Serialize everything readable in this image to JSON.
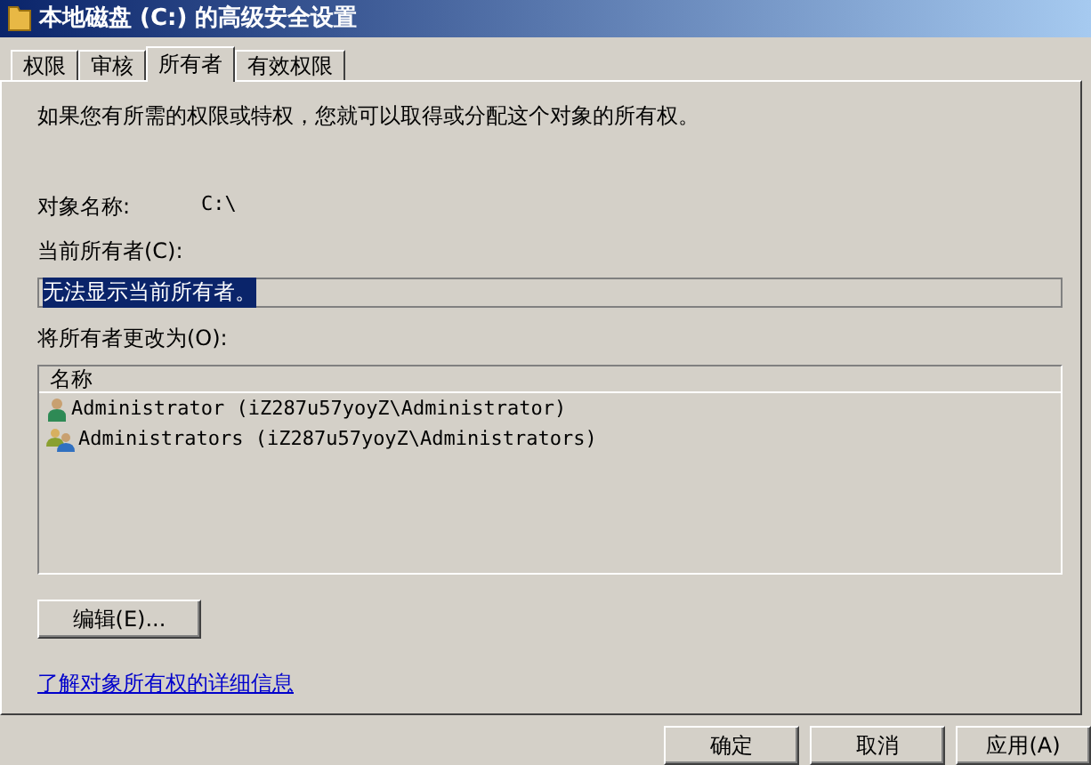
{
  "window": {
    "title": "本地磁盘 (C:) 的高级安全设置"
  },
  "tabs": [
    {
      "label": "权限",
      "selected": false
    },
    {
      "label": "审核",
      "selected": false
    },
    {
      "label": "所有者",
      "selected": true
    },
    {
      "label": "有效权限",
      "selected": false
    }
  ],
  "intro": "如果您有所需的权限或特权，您就可以取得或分配这个对象的所有权。",
  "object_name": {
    "label": "对象名称:",
    "value": "C:\\"
  },
  "current_owner": {
    "label": "当前所有者(C):",
    "value": "无法显示当前所有者。"
  },
  "change_owner": {
    "label": "将所有者更改为(O):",
    "column": "名称",
    "rows": [
      {
        "kind": "user",
        "name": "Administrator (iZ287u57yoyZ\\Administrator)",
        "selected": false
      },
      {
        "kind": "group",
        "name": "Administrators (iZ287u57yoyZ\\Administrators)",
        "selected": false
      }
    ]
  },
  "edit_button": "编辑(E)...",
  "link": "了解对象所有权的详细信息",
  "buttons": [
    "确定",
    "取消",
    "应用(A)"
  ]
}
